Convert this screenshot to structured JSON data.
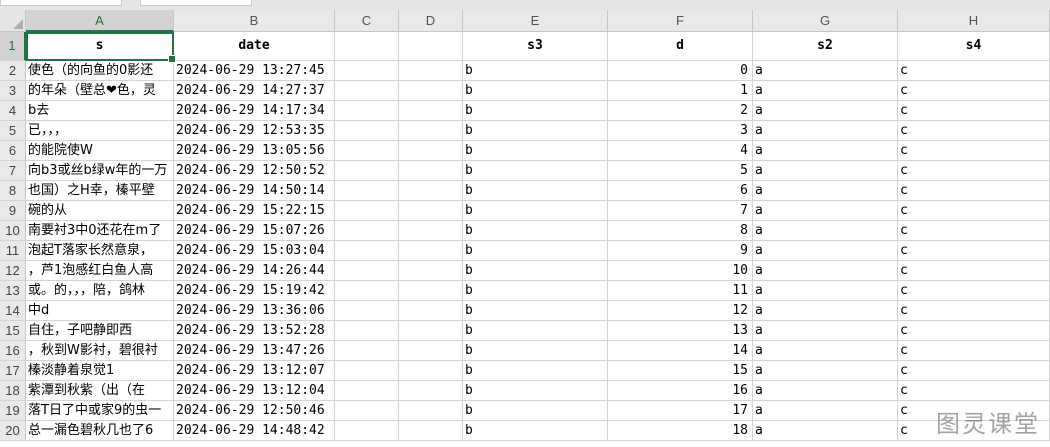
{
  "columns": [
    "A",
    "B",
    "C",
    "D",
    "E",
    "F",
    "G",
    "H"
  ],
  "selected_column": "A",
  "header_row": {
    "row": "1",
    "cells": [
      "s",
      "date",
      "",
      "",
      "s3",
      "d",
      "s2",
      "s4"
    ]
  },
  "rows": [
    {
      "row": "2",
      "s": "使色（的向鱼的0影还",
      "date": "2024-06-29 13:27:45",
      "s3": "b",
      "d": "0",
      "s2": "a",
      "s4": "c"
    },
    {
      "row": "3",
      "s": "的年朵（壁总❤色，灵",
      "date": "2024-06-29 14:27:37",
      "s3": "b",
      "d": "1",
      "s2": "a",
      "s4": "c"
    },
    {
      "row": "4",
      "s": "b去",
      "date": "2024-06-29 14:17:34",
      "s3": "b",
      "d": "2",
      "s2": "a",
      "s4": "c"
    },
    {
      "row": "5",
      "s": "已，，，",
      "date": "2024-06-29 12:53:35",
      "s3": "b",
      "d": "3",
      "s2": "a",
      "s4": "c"
    },
    {
      "row": "6",
      "s": "的能院使W",
      "date": "2024-06-29 13:05:56",
      "s3": "b",
      "d": "4",
      "s2": "a",
      "s4": "c"
    },
    {
      "row": "7",
      "s": "向b3或丝b绿w年的一万",
      "date": "2024-06-29 12:50:52",
      "s3": "b",
      "d": "5",
      "s2": "a",
      "s4": "c"
    },
    {
      "row": "8",
      "s": "也国）之H幸，榛平壁",
      "date": "2024-06-29 14:50:14",
      "s3": "b",
      "d": "6",
      "s2": "a",
      "s4": "c"
    },
    {
      "row": "9",
      "s": "碗的从",
      "date": "2024-06-29 15:22:15",
      "s3": "b",
      "d": "7",
      "s2": "a",
      "s4": "c"
    },
    {
      "row": "10",
      "s": "南要衬3中0还花在m了",
      "date": "2024-06-29 15:07:26",
      "s3": "b",
      "d": "8",
      "s2": "a",
      "s4": "c"
    },
    {
      "row": "11",
      "s": "泡起T落家长然意泉，",
      "date": "2024-06-29 15:03:04",
      "s3": "b",
      "d": "9",
      "s2": "a",
      "s4": "c"
    },
    {
      "row": "12",
      "s": "，芦1泡感红白鱼人高",
      "date": "2024-06-29 14:26:44",
      "s3": "b",
      "d": "10",
      "s2": "a",
      "s4": "c"
    },
    {
      "row": "13",
      "s": "或。的，，，陪，鸽林",
      "date": "2024-06-29 15:19:42",
      "s3": "b",
      "d": "11",
      "s2": "a",
      "s4": "c"
    },
    {
      "row": "14",
      "s": "中d",
      "date": "2024-06-29 13:36:06",
      "s3": "b",
      "d": "12",
      "s2": "a",
      "s4": "c"
    },
    {
      "row": "15",
      "s": "自住，子吧静即西",
      "date": "2024-06-29 13:52:28",
      "s3": "b",
      "d": "13",
      "s2": "a",
      "s4": "c"
    },
    {
      "row": "16",
      "s": "，秋到W影衬，碧很衬",
      "date": "2024-06-29 13:47:26",
      "s3": "b",
      "d": "14",
      "s2": "a",
      "s4": "c"
    },
    {
      "row": "17",
      "s": "榛淡静着泉觉1",
      "date": "2024-06-29 13:12:07",
      "s3": "b",
      "d": "15",
      "s2": "a",
      "s4": "c"
    },
    {
      "row": "18",
      "s": "紫潭到秋紫（出（在",
      "date": "2024-06-29 13:12:04",
      "s3": "b",
      "d": "16",
      "s2": "a",
      "s4": "c"
    },
    {
      "row": "19",
      "s": "落T日了中或家9的虫一",
      "date": "2024-06-29 12:50:46",
      "s3": "b",
      "d": "17",
      "s2": "a",
      "s4": "c"
    },
    {
      "row": "20",
      "s": "总一漏色碧秋几也了6",
      "date": "2024-06-29 14:48:42",
      "s3": "b",
      "d": "18",
      "s2": "a",
      "s4": "c"
    }
  ],
  "watermark": "图灵课堂",
  "colors": {
    "accent": "#217346",
    "header_bg": "#e9e9e9",
    "grid": "#d4d4d4"
  }
}
